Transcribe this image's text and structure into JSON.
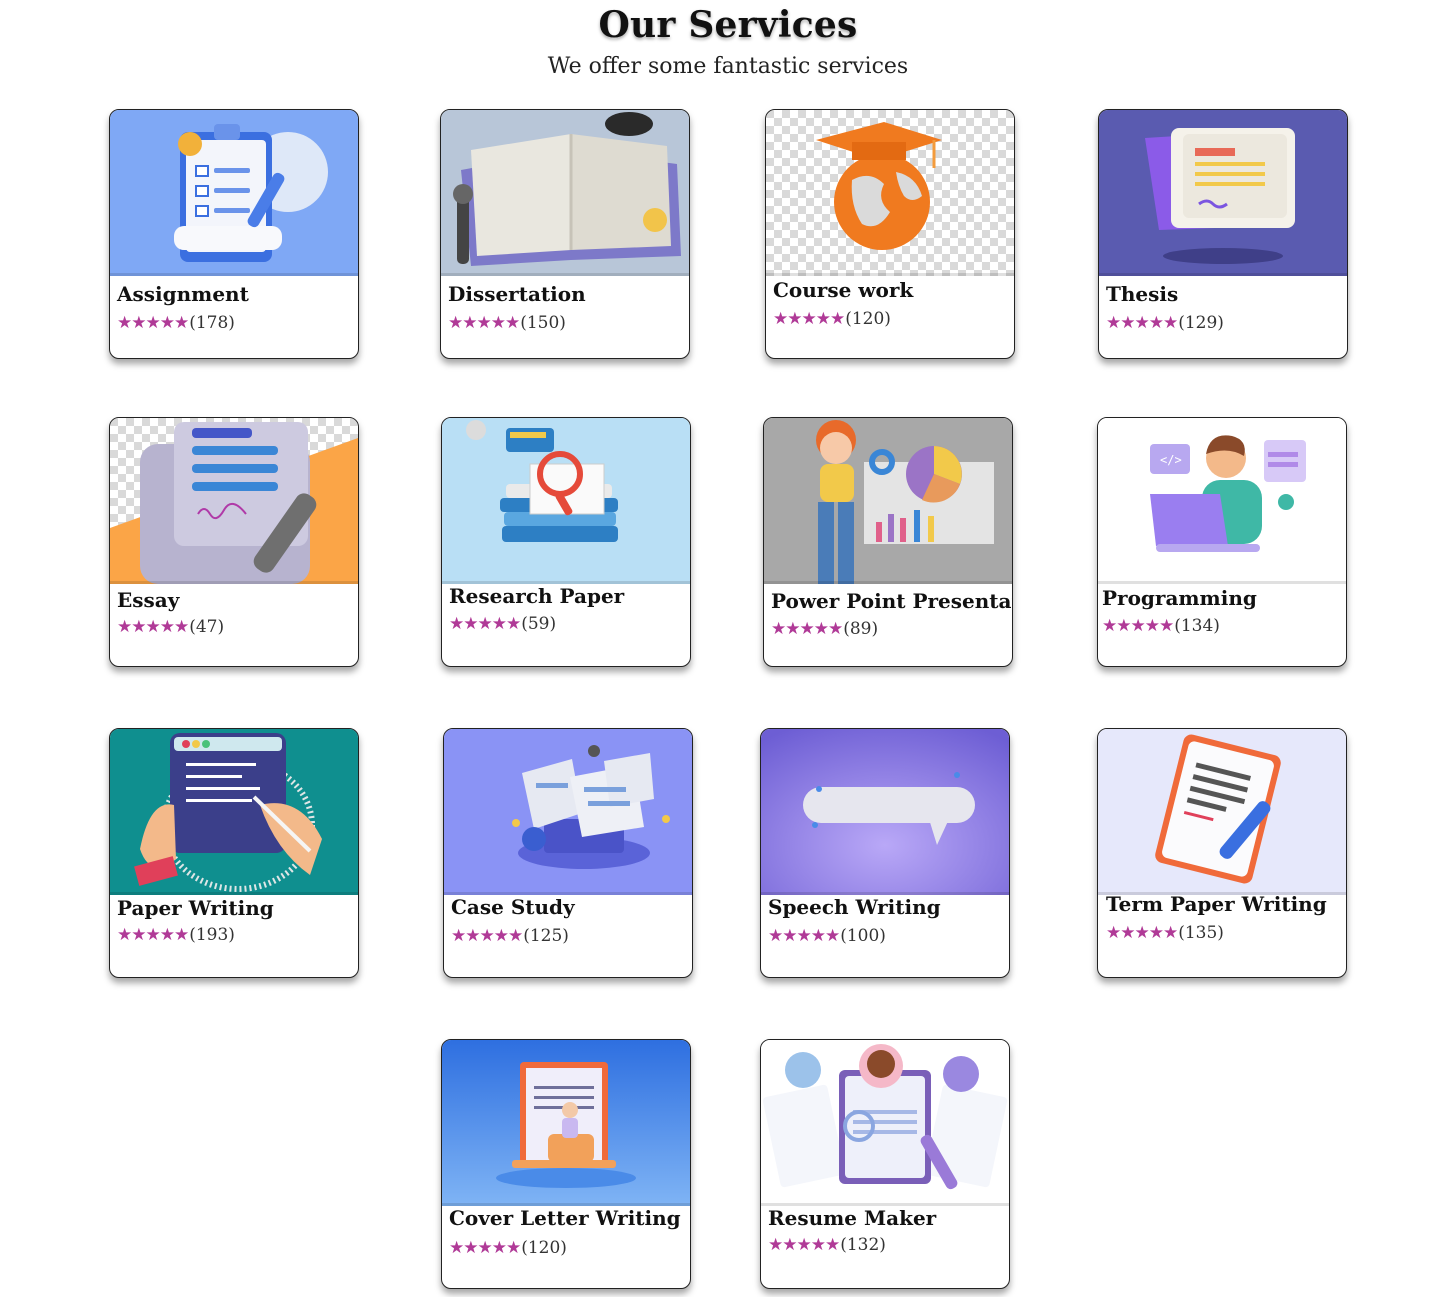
{
  "header": {
    "title": "Our Services",
    "subtitle": "We offer some fantastic services"
  },
  "star_color": "#b03a97",
  "services": [
    {
      "name": "Assignment",
      "stars": 5,
      "stars_text": "★★★★★",
      "count": "(178)",
      "icon": "checklist-clipboard-illustration"
    },
    {
      "name": "Dissertation",
      "stars": 5,
      "stars_text": "★★★★★",
      "count": "(150)",
      "icon": "open-book-illustration"
    },
    {
      "name": "Course work",
      "stars": 5,
      "stars_text": "★★★★★",
      "count": "(120)",
      "icon": "graduation-globe-illustration"
    },
    {
      "name": "Thesis",
      "stars": 5,
      "stars_text": "★★★★★",
      "count": "(129)",
      "icon": "documents-illustration"
    },
    {
      "name": "Essay",
      "stars": 5,
      "stars_text": "★★★★★",
      "count": "(47)",
      "icon": "signed-document-illustration"
    },
    {
      "name": "Research Paper",
      "stars": 5,
      "stars_text": "★★★★★",
      "count": "(59)",
      "icon": "books-magnifier-illustration"
    },
    {
      "name": "Power Point Presentation",
      "stars": 5,
      "stars_text": "★★★★★",
      "count": "(89)",
      "icon": "presenter-charts-illustration"
    },
    {
      "name": "Programming",
      "stars": 5,
      "stars_text": "★★★★★",
      "count": "(134)",
      "icon": "programmer-laptop-illustration"
    },
    {
      "name": "Paper Writing",
      "stars": 5,
      "stars_text": "★★★★★",
      "count": "(193)",
      "icon": "tablet-writing-illustration"
    },
    {
      "name": "Case Study",
      "stars": 5,
      "stars_text": "★★★★★",
      "count": "(125)",
      "icon": "newspapers-laptop-illustration"
    },
    {
      "name": "Speech Writing",
      "stars": 5,
      "stars_text": "★★★★★",
      "count": "(100)",
      "icon": "speech-bubble-illustration"
    },
    {
      "name": "Term Paper Writing",
      "stars": 5,
      "stars_text": "★★★★★",
      "count": "(135)",
      "icon": "notepad-pen-illustration"
    },
    {
      "name": "Cover Letter Writing",
      "stars": 5,
      "stars_text": "★★★★★",
      "count": "(120)",
      "icon": "cover-letter-illustration"
    },
    {
      "name": "Resume Maker",
      "stars": 5,
      "stars_text": "★★★★★",
      "count": "(132)",
      "icon": "resume-profiles-illustration"
    }
  ]
}
